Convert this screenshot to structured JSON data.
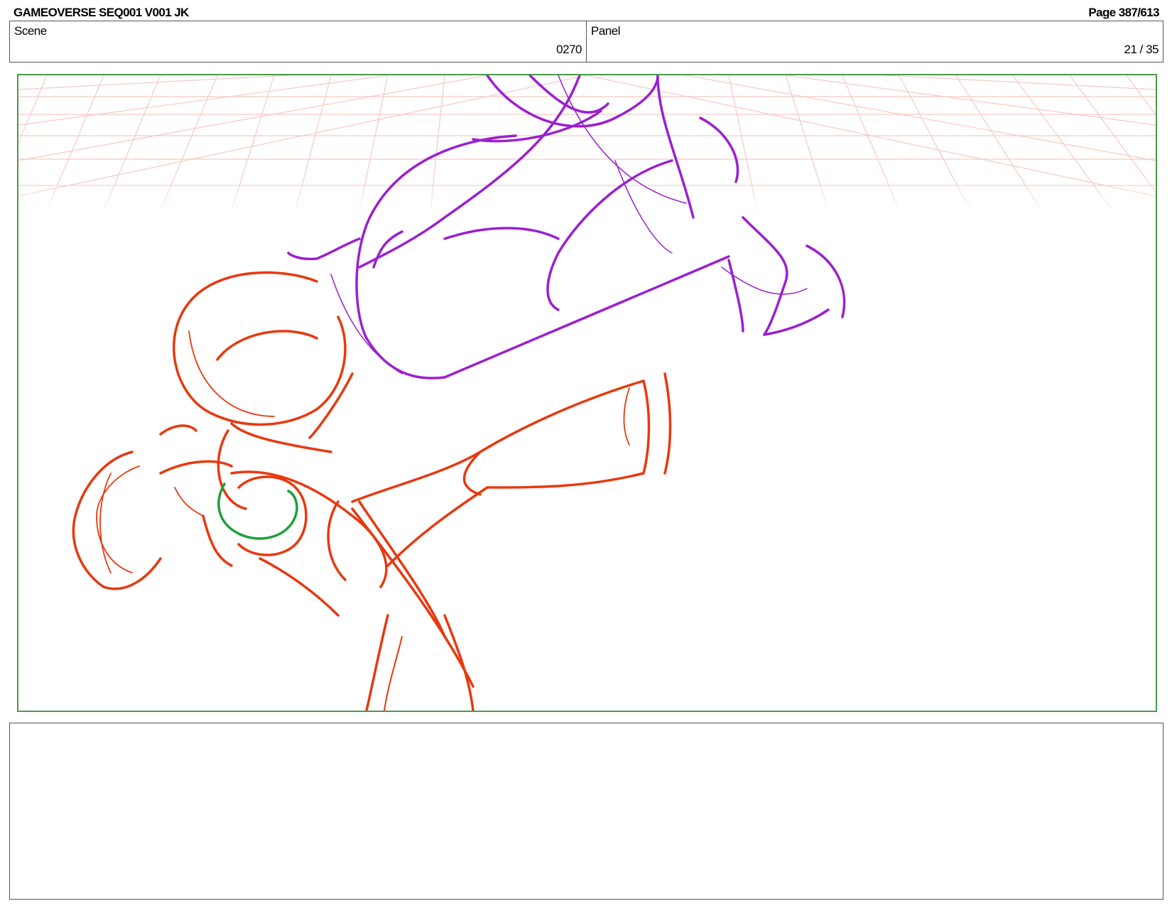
{
  "header": {
    "title": "GAMEOVERSE SEQ001 V001 JK",
    "page": "Page 387/613"
  },
  "scene": {
    "label": "Scene",
    "value": "0270"
  },
  "panel": {
    "label": "Panel",
    "value": "21 / 35"
  },
  "colors": {
    "frame_border": "#4a9a4a",
    "grid": "#f4b8b0",
    "sketch_red": "#e8380f",
    "sketch_purple": "#9b1fd0",
    "sketch_green": "#1aa23a"
  },
  "notes": {
    "text": ""
  }
}
